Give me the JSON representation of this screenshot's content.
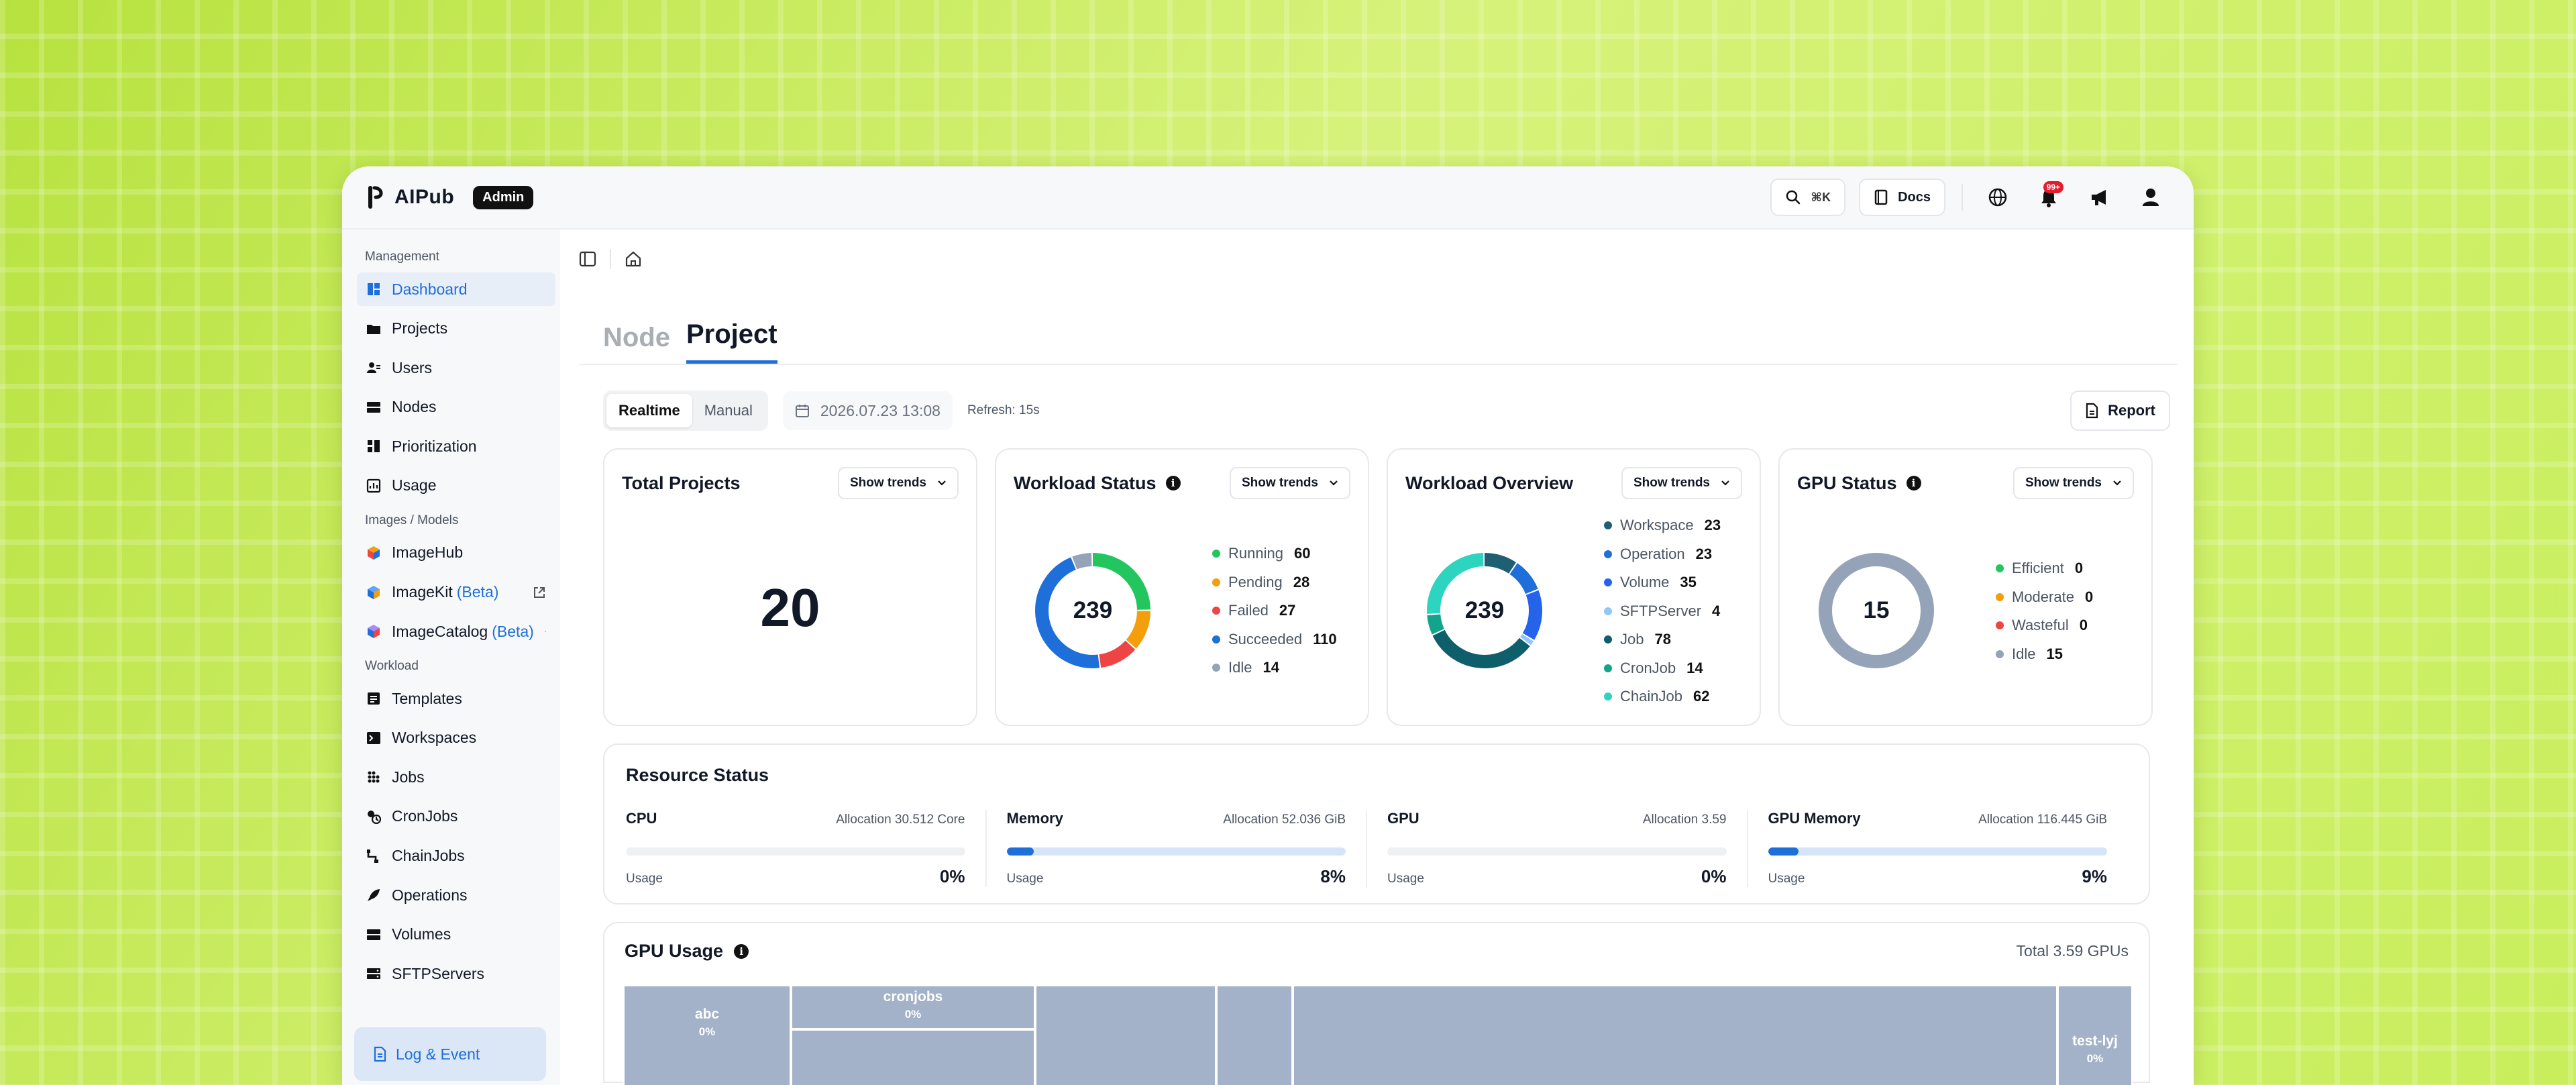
{
  "brand": {
    "name": "AIPub",
    "badge": "Admin"
  },
  "topbar": {
    "search_shortcut": "⌘K",
    "docs_label": "Docs",
    "notification_count": "99+"
  },
  "sidebar": {
    "management_title": "Management",
    "management": [
      {
        "label": "Dashboard",
        "icon": "dashboard-icon",
        "active": true
      },
      {
        "label": "Projects",
        "icon": "folder-icon"
      },
      {
        "label": "Users",
        "icon": "users-icon"
      },
      {
        "label": "Nodes",
        "icon": "server-icon"
      },
      {
        "label": "Prioritization",
        "icon": "prioritization-icon"
      },
      {
        "label": "Usage",
        "icon": "usage-icon"
      }
    ],
    "images_title": "Images / Models",
    "images": [
      {
        "label": "ImageHub",
        "icon": "imagehub-icon"
      },
      {
        "label": "ImageKit",
        "beta": "(Beta)",
        "icon": "imagekit-icon"
      },
      {
        "label": "ImageCatalog",
        "beta": "(Beta)",
        "icon": "imagecatalog-icon"
      }
    ],
    "workload_title": "Workload",
    "workload": [
      {
        "label": "Templates",
        "icon": "templates-icon"
      },
      {
        "label": "Workspaces",
        "icon": "terminal-icon"
      },
      {
        "label": "Jobs",
        "icon": "jobs-icon"
      },
      {
        "label": "CronJobs",
        "icon": "cronjobs-icon"
      },
      {
        "label": "ChainJobs",
        "icon": "chainjobs-icon"
      },
      {
        "label": "Operations",
        "icon": "rocket-icon"
      },
      {
        "label": "Volumes",
        "icon": "volume-icon"
      },
      {
        "label": "SFTPServers",
        "icon": "sftp-icon"
      }
    ],
    "log_event": "Log & Event"
  },
  "tabs": [
    "Node",
    "Project"
  ],
  "toolbar": {
    "realtime": "Realtime",
    "manual": "Manual",
    "date": "2026.07.23 13:08",
    "refresh": "Refresh: 15s",
    "report": "Report"
  },
  "cards": {
    "show_trends": "Show trends",
    "total_projects": {
      "title": "Total Projects",
      "value": "20"
    },
    "workload_status": {
      "title": "Workload Status",
      "total": "239",
      "items": [
        {
          "label": "Running",
          "value": "60",
          "color": "#22c55e"
        },
        {
          "label": "Pending",
          "value": "28",
          "color": "#f59e0b"
        },
        {
          "label": "Failed",
          "value": "27",
          "color": "#ef4444"
        },
        {
          "label": "Succeeded",
          "value": "110",
          "color": "#1e6fd9"
        },
        {
          "label": "Idle",
          "value": "14",
          "color": "#94a3b8"
        }
      ]
    },
    "workload_overview": {
      "title": "Workload Overview",
      "total": "239",
      "items": [
        {
          "label": "Workspace",
          "value": "23",
          "color": "#1f5f73"
        },
        {
          "label": "Operation",
          "value": "23",
          "color": "#1e6fd9"
        },
        {
          "label": "Volume",
          "value": "35",
          "color": "#2563eb"
        },
        {
          "label": "SFTPServer",
          "value": "4",
          "color": "#93c5fd"
        },
        {
          "label": "Job",
          "value": "78",
          "color": "#0f5e6b"
        },
        {
          "label": "CronJob",
          "value": "14",
          "color": "#14a38b"
        },
        {
          "label": "ChainJob",
          "value": "62",
          "color": "#2dd4bf"
        }
      ]
    },
    "gpu_status": {
      "title": "GPU Status",
      "total": "15",
      "items": [
        {
          "label": "Efficient",
          "value": "0",
          "color": "#22c55e"
        },
        {
          "label": "Moderate",
          "value": "0",
          "color": "#f59e0b"
        },
        {
          "label": "Wasteful",
          "value": "0",
          "color": "#ef4444"
        },
        {
          "label": "Idle",
          "value": "15",
          "color": "#94a3b8"
        }
      ]
    }
  },
  "resource": {
    "title": "Resource Status",
    "usage_label": "Usage",
    "items": [
      {
        "name": "CPU",
        "allocation": "Allocation 30.512 Core",
        "usage": "0%",
        "fill": 0
      },
      {
        "name": "Memory",
        "allocation": "Allocation 52.036 GiB",
        "usage": "8%",
        "fill": 8
      },
      {
        "name": "GPU",
        "allocation": "Allocation 3.59",
        "usage": "0%",
        "fill": 0
      },
      {
        "name": "GPU Memory",
        "allocation": "Allocation 116.445 GiB",
        "usage": "9%",
        "fill": 9
      }
    ]
  },
  "gpu_usage": {
    "title": "GPU Usage",
    "total": "Total 3.59 GPUs",
    "blocks": [
      {
        "name": "abc",
        "pct": "0%"
      },
      {
        "name": "cronjobs",
        "pct": "0%"
      },
      {
        "name": "test-lyj",
        "pct": "0%"
      }
    ]
  }
}
